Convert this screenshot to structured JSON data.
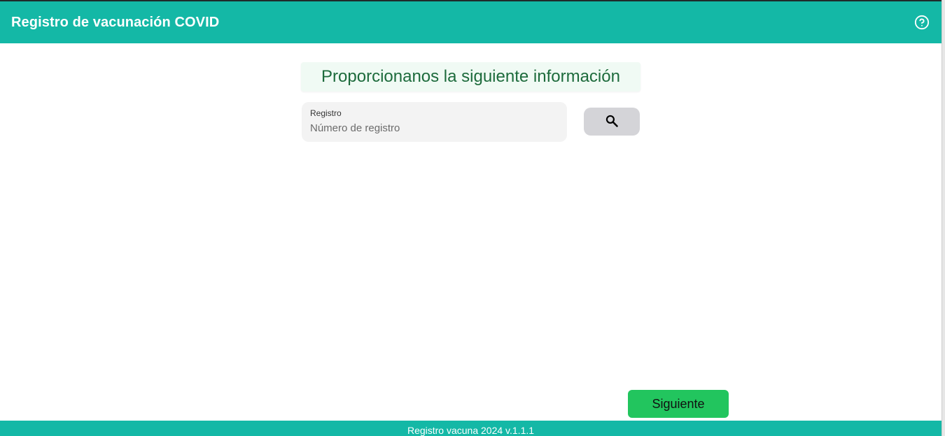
{
  "header": {
    "title": "Registro de vacunación COVID",
    "help_icon": "help-circle-icon"
  },
  "main": {
    "heading": "Proporcionanos la siguiente información",
    "registro_field": {
      "label": "Registro",
      "placeholder": "Número de registro",
      "value": ""
    },
    "search_button": {
      "icon": "search-icon"
    },
    "next_button": {
      "label": "Siguiente"
    }
  },
  "footer": {
    "text": "Registro vacuna 2024 v.1.1.1"
  },
  "colors": {
    "header_bg": "#14b8a6",
    "heading_text": "#1d6b3c",
    "heading_bg": "#f0faf4",
    "next_button_bg": "#22c55e",
    "search_button_bg": "#d4d4d8",
    "field_bg": "#f3f3f3"
  }
}
